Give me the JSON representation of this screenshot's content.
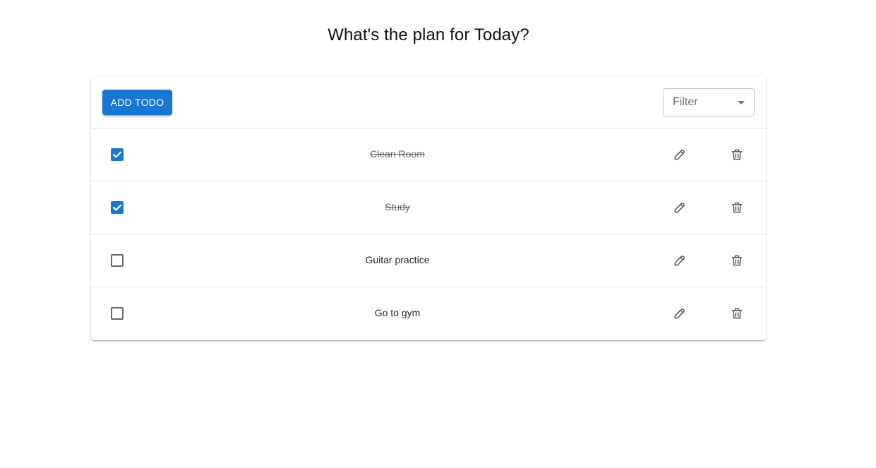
{
  "page": {
    "title": "What's the plan for Today?"
  },
  "toolbar": {
    "add_label": "ADD TODO",
    "filter_label": "Filter"
  },
  "todos": [
    {
      "text": "Clean Room",
      "completed": true
    },
    {
      "text": "Study",
      "completed": true
    },
    {
      "text": "Guitar practice",
      "completed": false
    },
    {
      "text": "Go to gym",
      "completed": false
    }
  ],
  "icons": {
    "edit": "edit-icon",
    "delete": "trash-icon",
    "filter": "arrow-drop-down-icon"
  },
  "colors": {
    "primary": "#1976d2"
  }
}
